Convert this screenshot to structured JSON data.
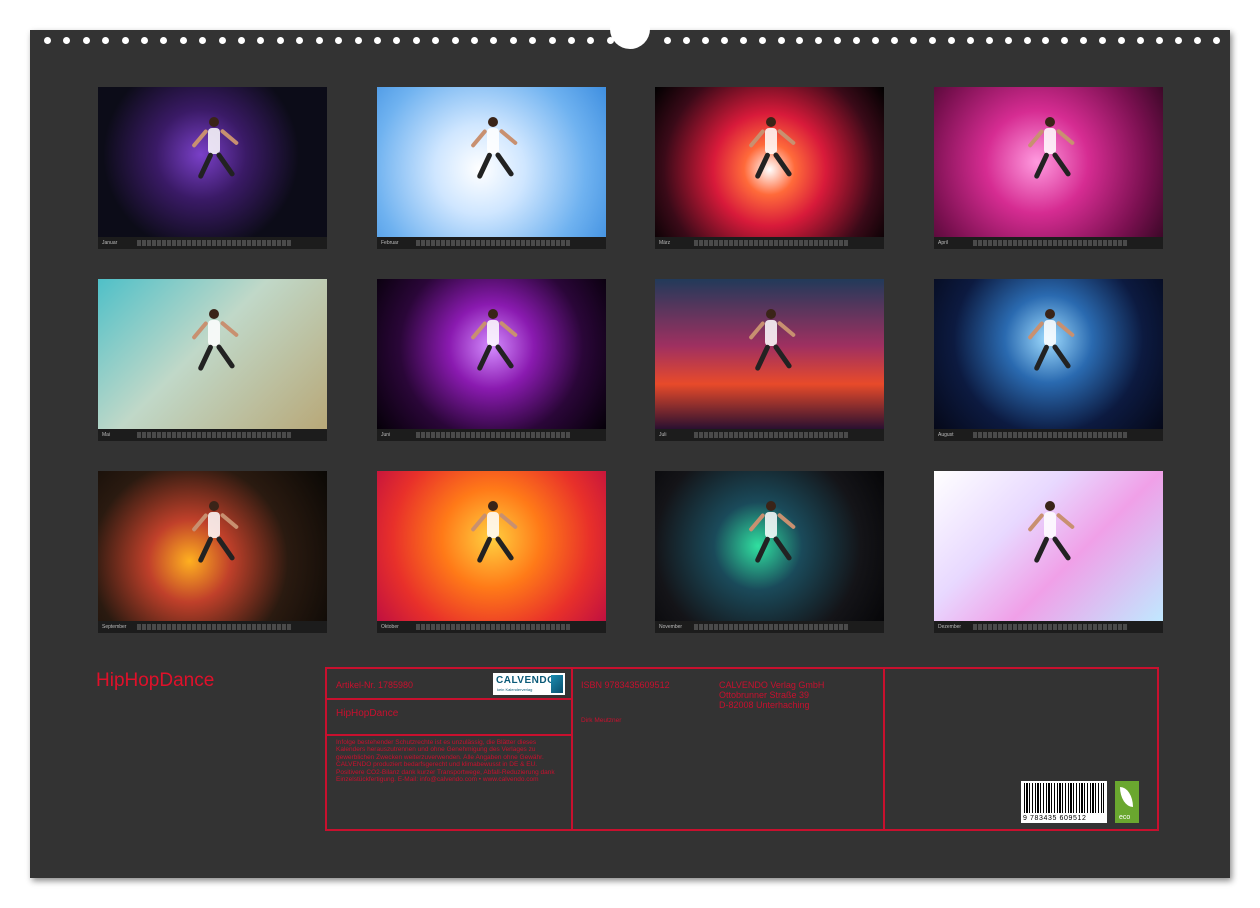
{
  "calendar": {
    "title": "HipHopDance",
    "months": [
      {
        "label": "Januar"
      },
      {
        "label": "Februar"
      },
      {
        "label": "März"
      },
      {
        "label": "April"
      },
      {
        "label": "Mai"
      },
      {
        "label": "Juni"
      },
      {
        "label": "Juli"
      },
      {
        "label": "August"
      },
      {
        "label": "September"
      },
      {
        "label": "Oktober"
      },
      {
        "label": "November"
      },
      {
        "label": "Dezember"
      }
    ]
  },
  "info": {
    "article_no": "Artikel-Nr. 1785980",
    "product_title": "HipHopDance",
    "legal_text": "Infolge bestehender Schutzrechte ist es unzulässig, die Blätter dieses Kalenders herauszutrennen und ohne Genehmigung des Verlages zu gewerblichen Zwecken weiterzuverwenden. Alle Angaben ohne Gewähr. CALVENDO produziert bedarfsgerecht und klimabewusst in DE & EU. Positivere CO2-Bilanz dank kurzer Transportwege, Abfall-Reduzierung dank Einzelstückfertigung. E-Mail: info@calvendo.com • www.calvendo.com",
    "isbn": "ISBN 9783435609512",
    "author": "Dirk Meutzner",
    "publisher_lines": [
      "CALVENDO Verlag GmbH",
      "Ottobrunner Straße 39",
      "D-82008 Unterhaching"
    ],
    "logo_text": "CALVENDO",
    "logo_subtext": "kein Kalenderverlag",
    "barcode_number": "9 783435 609512",
    "eco_label": "eco"
  },
  "colors": {
    "accent": "#c8102e",
    "sheet": "#333333"
  }
}
